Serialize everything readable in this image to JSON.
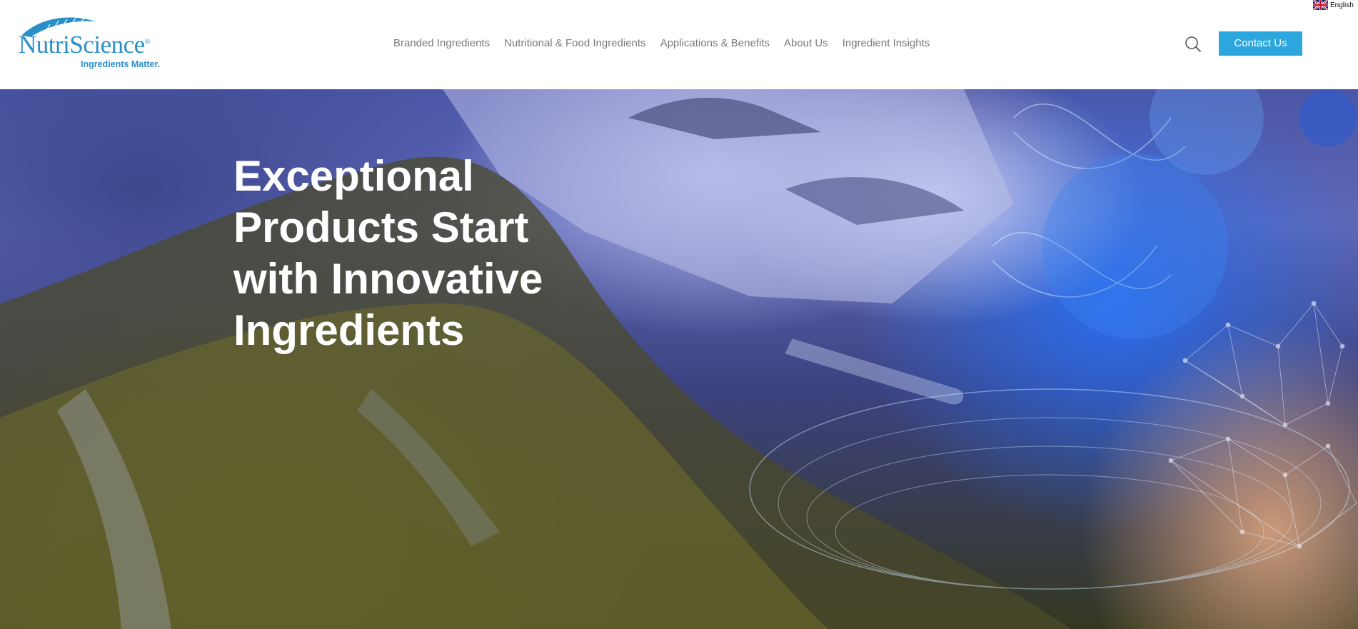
{
  "brand": {
    "name": "NutriScience",
    "registered_mark": "®",
    "tagline": "Ingredients Matter.",
    "color": "#2a8fc9"
  },
  "nav": {
    "items": [
      {
        "label": "Branded Ingredients"
      },
      {
        "label": "Nutritional & Food Ingredients"
      },
      {
        "label": "Applications & Benefits"
      },
      {
        "label": "About Us"
      },
      {
        "label": "Ingredient Insights"
      }
    ]
  },
  "header": {
    "search_icon": "search-icon",
    "contact_label": "Contact Us",
    "contact_color": "#2ba7de"
  },
  "language": {
    "label": "English",
    "flag_icon": "uk-flag-icon"
  },
  "hero": {
    "title_lines": [
      "Exceptional",
      "Products Start",
      "with Innovative",
      "Ingredients"
    ]
  }
}
